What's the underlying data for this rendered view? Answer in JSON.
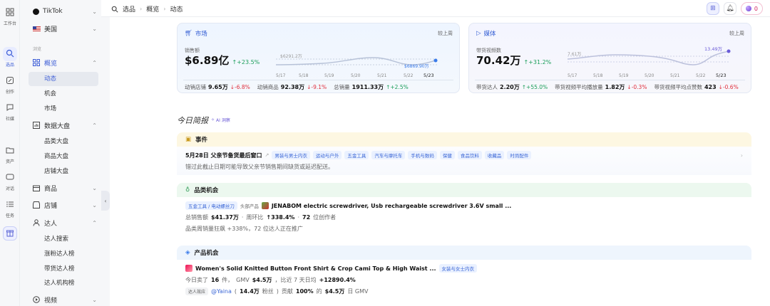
{
  "rail": {
    "items": [
      {
        "label": "工作台",
        "icon": "grid-icon"
      },
      {
        "label": "选品",
        "icon": "search-icon",
        "active": true
      },
      {
        "label": "创作",
        "icon": "create-icon"
      },
      {
        "label": "社媒",
        "icon": "social-icon"
      },
      {
        "label": "资产",
        "icon": "folder-icon"
      },
      {
        "label": "对话",
        "icon": "chat-icon"
      },
      {
        "label": "任务",
        "icon": "task-icon"
      },
      {
        "label": "",
        "icon": "gift-icon"
      }
    ]
  },
  "sidebar": {
    "platform": "TikTok",
    "region": "美国",
    "heading": "浏览",
    "overview": "概览",
    "overview_items": [
      "动态",
      "机会",
      "市场"
    ],
    "bigdata": "数据大盘",
    "bigdata_items": [
      "品类大盘",
      "商品大盘",
      "店铺大盘"
    ],
    "goods": "商品",
    "shops": "店铺",
    "creators": "达人",
    "creator_items": [
      "达人搜索",
      "涨粉达人榜",
      "带货达人榜",
      "达人机构榜"
    ],
    "videos": "视频"
  },
  "header": {
    "crumbs": [
      "选品",
      "概览",
      "动态"
    ],
    "coins": "0"
  },
  "market_card": {
    "title": "市场",
    "compare": "较上周",
    "metric_label": "销售额",
    "metric_value": "$6.89亿",
    "metric_change": "↑+23.5%",
    "chart_start_label": "$6291.2万",
    "chart_end_label": "$6869.90万",
    "dates": [
      "5/17",
      "5/18",
      "5/19",
      "5/20",
      "5/21",
      "5/22",
      "5/23"
    ],
    "stats": [
      {
        "label": "动销店铺",
        "value": "9.65万",
        "change": "↓-6.8%",
        "dir": "down"
      },
      {
        "label": "动销商品",
        "value": "92.38万",
        "change": "↓-9.1%",
        "dir": "down"
      },
      {
        "label": "总销量",
        "value": "1911.33万",
        "change": "↑+2.5%",
        "dir": "up"
      }
    ]
  },
  "media_card": {
    "title": "媒体",
    "compare": "较上周",
    "metric_label": "带货视频数",
    "metric_value": "70.42万",
    "metric_change": "↑+31.2%",
    "chart_start_label": "7.61万",
    "chart_end_label": "13.49万",
    "dates": [
      "5/17",
      "5/18",
      "5/19",
      "5/20",
      "5/21",
      "5/22",
      "5/23"
    ],
    "stats": [
      {
        "label": "带货达人",
        "value": "2.20万",
        "change": "↑+55.0%",
        "dir": "up"
      },
      {
        "label": "带货视频平均播放量",
        "value": "1.82万",
        "change": "↓-0.3%",
        "dir": "down"
      },
      {
        "label": "带货视频平均点赞数",
        "value": "423",
        "change": "↓-0.6%",
        "dir": "down"
      }
    ]
  },
  "brief": {
    "title": "今日简报",
    "ai_tag": "AI 洞察"
  },
  "event": {
    "title": "事件",
    "headline": "5月28日 父亲节备货最后窗口",
    "tags": [
      "男装与男士内衣",
      "运动与户外",
      "五金工具",
      "汽车与摩托车",
      "手机与数码",
      "保健",
      "食品饮料",
      "收藏品",
      "时尚配件"
    ],
    "desc": "错过此截止日期可能导致父亲节销售期间缺货或延迟配送。"
  },
  "category": {
    "title": "品类机会",
    "tag": "五金工具 / 电动螺丝刀",
    "top_label": "头部产品",
    "product": "JENABOM electric screwdriver, Usb rechargeable screwdriver 3.6V small ...",
    "gmv_label": "总销售额",
    "gmv": "$41.37万",
    "wow_label": "周环比",
    "wow": "↑338.4%",
    "creators": "72",
    "creators_label": "位创作者",
    "desc": "品类周销量狂飙 +338%，72 位达人正在推广"
  },
  "product": {
    "title": "产品机会",
    "name": "Women's Solid Knitted Button Front Shirt & Crop Cami Top & High Waist ...",
    "tag": "女装与女士内衣",
    "sold_prefix": "今日卖了",
    "sold": "16",
    "sold_unit": "件，",
    "gmv_prefix": "GMV",
    "gmv": "$4.5万",
    "cmp_prefix": "，比近 7 天日均",
    "cmp": "+12890.4%",
    "creator_tag": "达人效应",
    "creator": "@Yaina",
    "fans": "14.4万",
    "fans_label": "粉丝",
    "contrib_prefix": "贡献",
    "contrib": "100%",
    "contrib_mid": "的",
    "contrib_gmv": "$4.5万",
    "contrib_suffix": "日 GMV"
  }
}
